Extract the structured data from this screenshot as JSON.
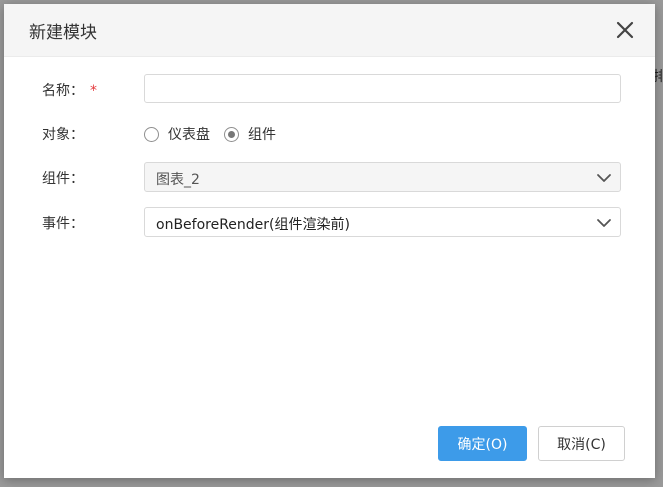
{
  "background": {
    "partial_text": "排"
  },
  "dialog": {
    "title": "新建模块",
    "close_icon": "close-icon"
  },
  "form": {
    "name": {
      "label": "名称：",
      "required_mark": "*",
      "value": "",
      "placeholder": ""
    },
    "target": {
      "label": "对象：",
      "options": [
        {
          "label": "仪表盘",
          "checked": false
        },
        {
          "label": "组件",
          "checked": true
        }
      ]
    },
    "component": {
      "label": "组件：",
      "value": "图表_2",
      "disabled": true
    },
    "event": {
      "label": "事件：",
      "value": "onBeforeRender(组件渲染前)",
      "disabled": false
    }
  },
  "footer": {
    "ok_label": "确定(O)",
    "cancel_label": "取消(C)"
  },
  "colors": {
    "primary": "#3d9be9",
    "required": "#e4393c",
    "header_bg": "#f5f5f5"
  }
}
